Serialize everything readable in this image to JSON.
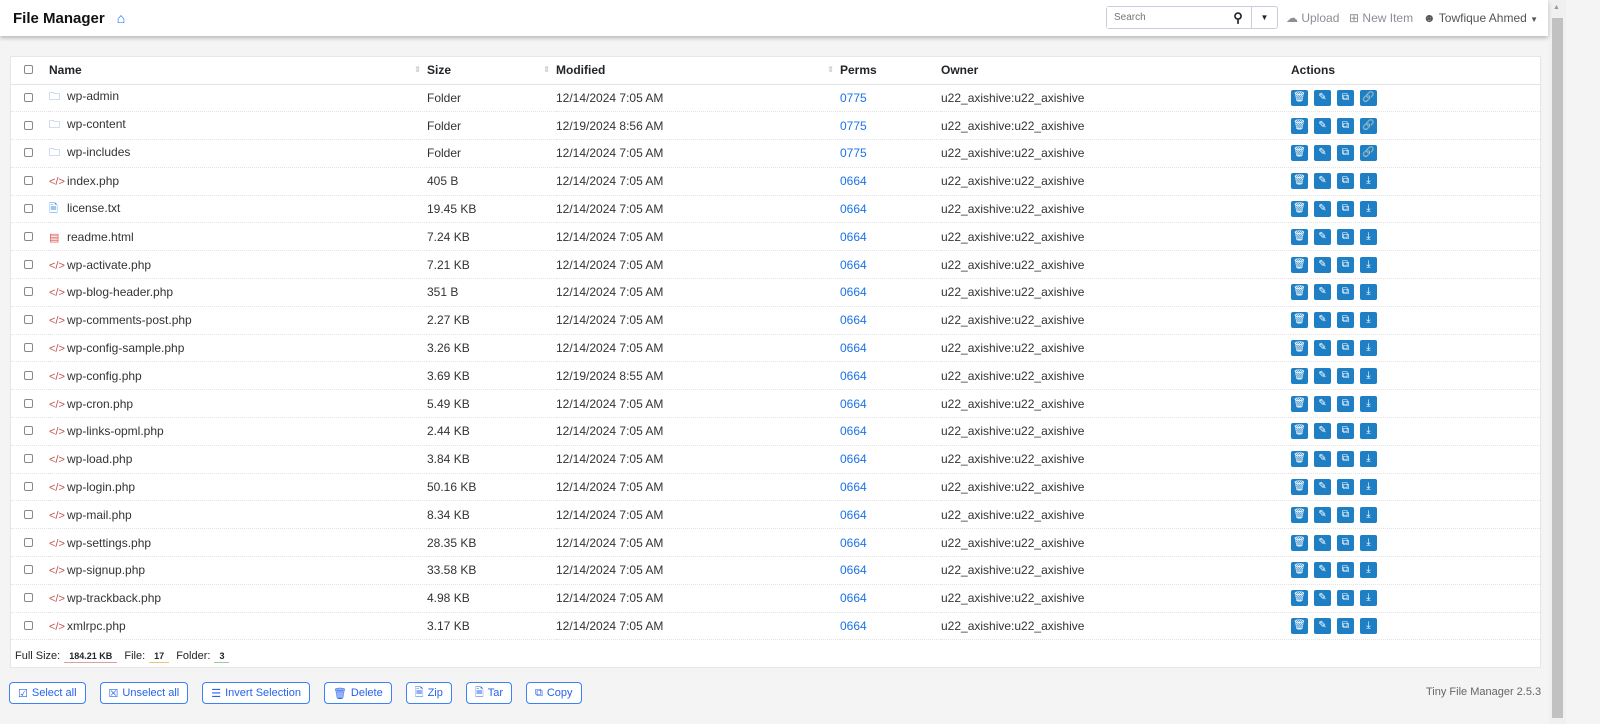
{
  "header": {
    "title": "File Manager",
    "search_placeholder": "Search",
    "upload": "Upload",
    "new_item": "New Item",
    "user": "Towfique Ahmed"
  },
  "table": {
    "columns": [
      "Name",
      "Size",
      "Modified",
      "Perms",
      "Owner",
      "Actions"
    ],
    "rows": [
      {
        "name": "wp-admin",
        "type": "folder",
        "size": "Folder",
        "modified": "12/14/2024 7:05 AM",
        "perms": "0775",
        "owner": "u22_axishive:u22_axishive"
      },
      {
        "name": "wp-content",
        "type": "folder",
        "size": "Folder",
        "modified": "12/19/2024 8:56 AM",
        "perms": "0775",
        "owner": "u22_axishive:u22_axishive"
      },
      {
        "name": "wp-includes",
        "type": "folder",
        "size": "Folder",
        "modified": "12/14/2024 7:05 AM",
        "perms": "0775",
        "owner": "u22_axishive:u22_axishive"
      },
      {
        "name": "index.php",
        "type": "code",
        "size": "405 B",
        "modified": "12/14/2024 7:05 AM",
        "perms": "0664",
        "owner": "u22_axishive:u22_axishive"
      },
      {
        "name": "license.txt",
        "type": "txt",
        "size": "19.45 KB",
        "modified": "12/14/2024 7:05 AM",
        "perms": "0664",
        "owner": "u22_axishive:u22_axishive"
      },
      {
        "name": "readme.html",
        "type": "html",
        "size": "7.24 KB",
        "modified": "12/14/2024 7:05 AM",
        "perms": "0664",
        "owner": "u22_axishive:u22_axishive"
      },
      {
        "name": "wp-activate.php",
        "type": "code",
        "size": "7.21 KB",
        "modified": "12/14/2024 7:05 AM",
        "perms": "0664",
        "owner": "u22_axishive:u22_axishive"
      },
      {
        "name": "wp-blog-header.php",
        "type": "code",
        "size": "351 B",
        "modified": "12/14/2024 7:05 AM",
        "perms": "0664",
        "owner": "u22_axishive:u22_axishive"
      },
      {
        "name": "wp-comments-post.php",
        "type": "code",
        "size": "2.27 KB",
        "modified": "12/14/2024 7:05 AM",
        "perms": "0664",
        "owner": "u22_axishive:u22_axishive"
      },
      {
        "name": "wp-config-sample.php",
        "type": "code",
        "size": "3.26 KB",
        "modified": "12/14/2024 7:05 AM",
        "perms": "0664",
        "owner": "u22_axishive:u22_axishive"
      },
      {
        "name": "wp-config.php",
        "type": "code",
        "size": "3.69 KB",
        "modified": "12/19/2024 8:55 AM",
        "perms": "0664",
        "owner": "u22_axishive:u22_axishive"
      },
      {
        "name": "wp-cron.php",
        "type": "code",
        "size": "5.49 KB",
        "modified": "12/14/2024 7:05 AM",
        "perms": "0664",
        "owner": "u22_axishive:u22_axishive"
      },
      {
        "name": "wp-links-opml.php",
        "type": "code",
        "size": "2.44 KB",
        "modified": "12/14/2024 7:05 AM",
        "perms": "0664",
        "owner": "u22_axishive:u22_axishive"
      },
      {
        "name": "wp-load.php",
        "type": "code",
        "size": "3.84 KB",
        "modified": "12/14/2024 7:05 AM",
        "perms": "0664",
        "owner": "u22_axishive:u22_axishive"
      },
      {
        "name": "wp-login.php",
        "type": "code",
        "size": "50.16 KB",
        "modified": "12/14/2024 7:05 AM",
        "perms": "0664",
        "owner": "u22_axishive:u22_axishive"
      },
      {
        "name": "wp-mail.php",
        "type": "code",
        "size": "8.34 KB",
        "modified": "12/14/2024 7:05 AM",
        "perms": "0664",
        "owner": "u22_axishive:u22_axishive"
      },
      {
        "name": "wp-settings.php",
        "type": "code",
        "size": "28.35 KB",
        "modified": "12/14/2024 7:05 AM",
        "perms": "0664",
        "owner": "u22_axishive:u22_axishive"
      },
      {
        "name": "wp-signup.php",
        "type": "code",
        "size": "33.58 KB",
        "modified": "12/14/2024 7:05 AM",
        "perms": "0664",
        "owner": "u22_axishive:u22_axishive"
      },
      {
        "name": "wp-trackback.php",
        "type": "code",
        "size": "4.98 KB",
        "modified": "12/14/2024 7:05 AM",
        "perms": "0664",
        "owner": "u22_axishive:u22_axishive"
      },
      {
        "name": "xmlrpc.php",
        "type": "code",
        "size": "3.17 KB",
        "modified": "12/14/2024 7:05 AM",
        "perms": "0664",
        "owner": "u22_axishive:u22_axishive"
      }
    ]
  },
  "summary": {
    "full_size_label": "Full Size:",
    "full_size": "184.21 KB",
    "file_label": "File:",
    "file_count": "17",
    "folder_label": "Folder:",
    "folder_count": "3"
  },
  "buttons": {
    "select_all": "Select all",
    "unselect_all": "Unselect all",
    "invert": "Invert Selection",
    "delete": "Delete",
    "zip": "Zip",
    "tar": "Tar",
    "copy": "Copy"
  },
  "footer": {
    "version": "Tiny File Manager 2.5.3"
  },
  "colors": {
    "accent": "#1f7fc4",
    "link": "#1a73e8"
  }
}
